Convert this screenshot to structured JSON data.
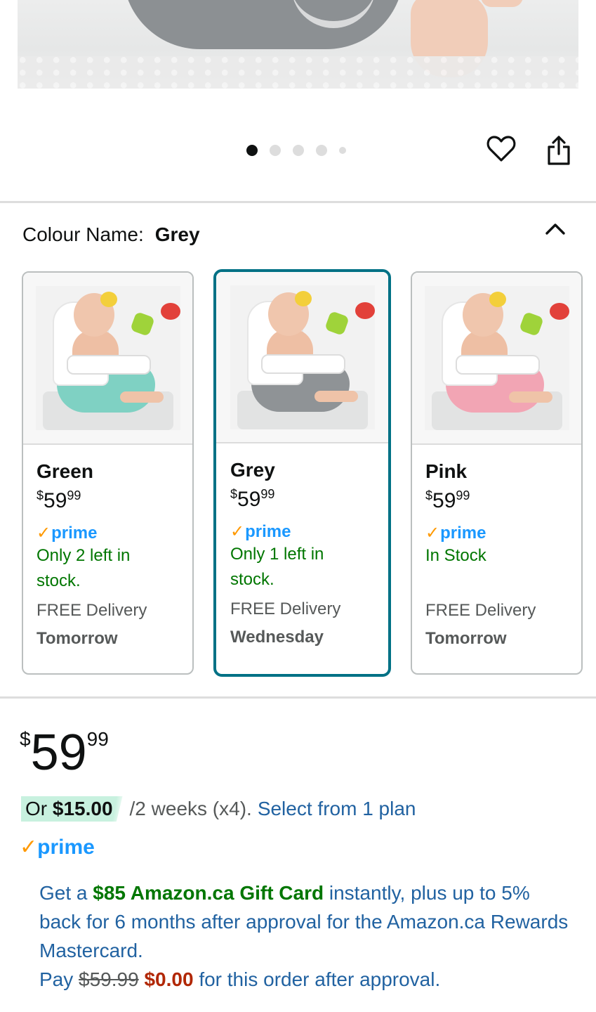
{
  "gallery": {
    "dots_total": 5,
    "active_index": 0
  },
  "actions": {
    "wishlist_icon": "heart-outline-icon",
    "share_icon": "share-icon"
  },
  "variation": {
    "label": "Colour Name:",
    "selected_value": "Grey",
    "toggle_icon": "chevron-up-icon",
    "options": [
      {
        "name": "Green",
        "price_symbol": "$",
        "price_whole": "59",
        "price_cents": "99",
        "prime": "prime",
        "stock": "Only 2 left in stock.",
        "delivery": "FREE Delivery",
        "delivery_day": "Tomorrow",
        "accent": "#7fd1c3"
      },
      {
        "name": "Grey",
        "price_symbol": "$",
        "price_whole": "59",
        "price_cents": "99",
        "prime": "prime",
        "stock": "Only 1 left in stock.",
        "delivery": "FREE Delivery",
        "delivery_day": "Wednesday",
        "accent": "#8f9396"
      },
      {
        "name": "Pink",
        "price_symbol": "$",
        "price_whole": "59",
        "price_cents": "99",
        "prime": "prime",
        "stock": "In Stock",
        "delivery": "FREE Delivery",
        "delivery_day": "Tomorrow",
        "accent": "#f2a5b4"
      }
    ]
  },
  "buybox": {
    "price_symbol": "$",
    "price_whole": "59",
    "price_cents": "99",
    "plan_or": "Or",
    "plan_amount": "$15.00",
    "plan_period": "/2 weeks (x4).",
    "plan_link": "Select from 1 plan",
    "prime": "prime",
    "offer": {
      "prefix": "Get a",
      "gift_card": "$85 Amazon.ca Gift Card",
      "body": "instantly, plus up to 5% back for 6 months after approval for the Amazon.ca Rewards Mastercard.",
      "pay": "Pay",
      "old_price": "$59.99",
      "new_price": "$0.00",
      "suffix": "for this order after approval."
    }
  },
  "colors": {
    "selected_border": "#007185",
    "prime_blue": "#1a98ff",
    "prime_check": "#ff9900",
    "stock_green": "#007600",
    "link_blue": "#2162a1",
    "deal_red": "#b12704",
    "plan_highlight": "#c8f1df"
  }
}
